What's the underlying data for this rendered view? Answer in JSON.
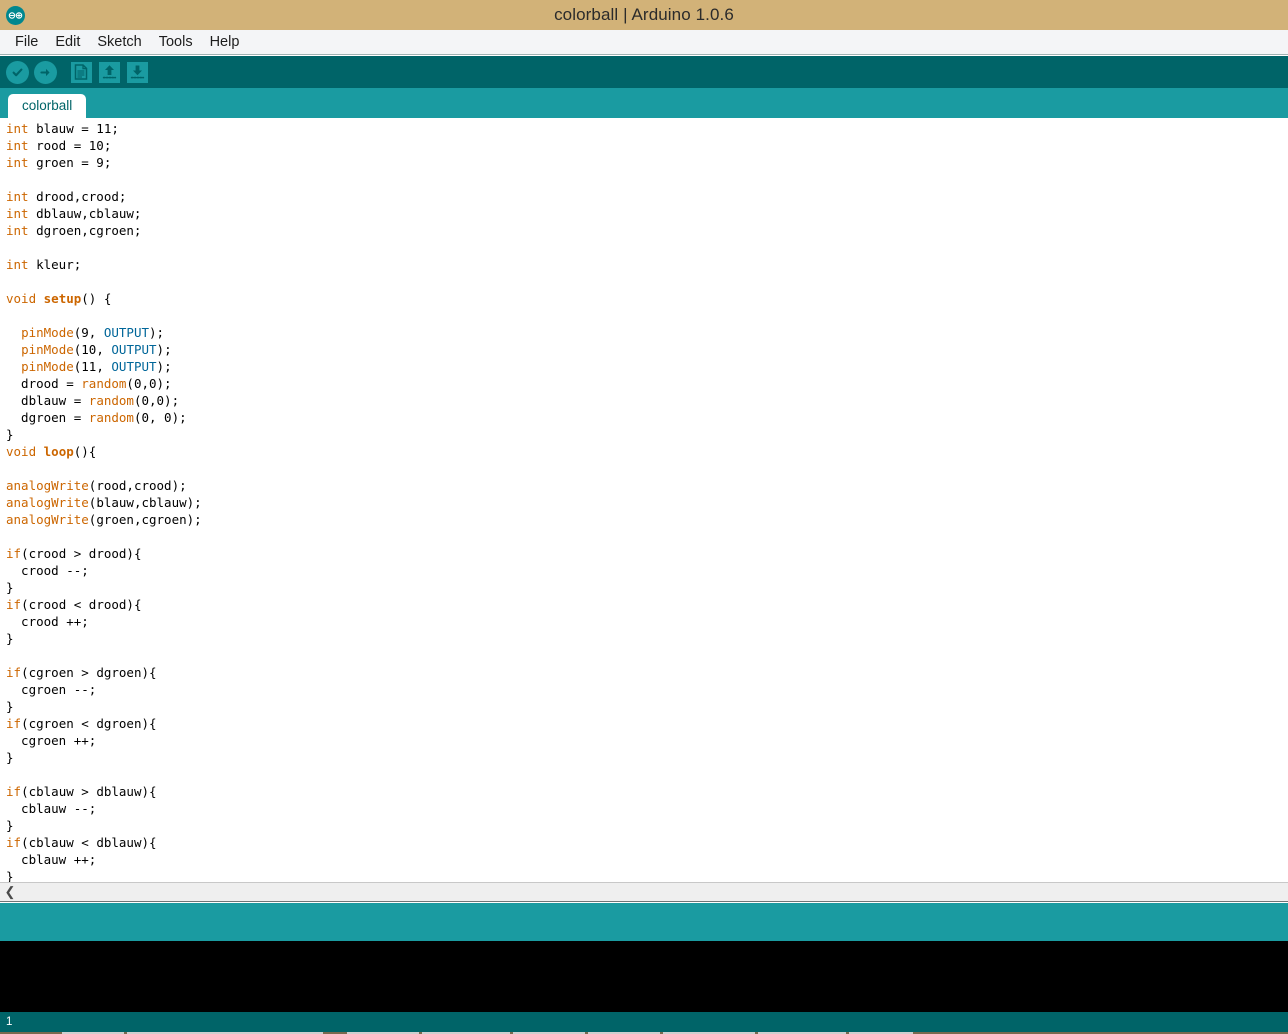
{
  "window": {
    "title": "colorball | Arduino 1.0.6",
    "logo_icon": "arduino-infinity-icon",
    "titlebar_color": "#d2b278",
    "accent_color": "#1a9ba1",
    "dark_accent_color": "#006468"
  },
  "menubar": {
    "items": [
      {
        "label": "File",
        "name": "menu-file"
      },
      {
        "label": "Edit",
        "name": "menu-edit"
      },
      {
        "label": "Sketch",
        "name": "menu-sketch"
      },
      {
        "label": "Tools",
        "name": "menu-tools"
      },
      {
        "label": "Help",
        "name": "menu-help"
      }
    ]
  },
  "toolbar": {
    "buttons": [
      {
        "name": "verify-button",
        "icon": "checkmark-icon",
        "tooltip": "Verify"
      },
      {
        "name": "upload-button",
        "icon": "right-arrow-icon",
        "tooltip": "Upload"
      },
      {
        "name": "new-button",
        "icon": "new-document-icon",
        "tooltip": "New"
      },
      {
        "name": "open-button",
        "icon": "up-arrow-icon",
        "tooltip": "Open"
      },
      {
        "name": "save-button",
        "icon": "down-arrow-icon",
        "tooltip": "Save"
      }
    ]
  },
  "tabs": [
    {
      "label": "colorball",
      "active": true
    }
  ],
  "editor": {
    "lines": [
      [
        {
          "t": "int",
          "c": "kw"
        },
        {
          "t": " blauw = 11;",
          "c": ""
        }
      ],
      [
        {
          "t": "int",
          "c": "kw"
        },
        {
          "t": " rood = 10;",
          "c": ""
        }
      ],
      [
        {
          "t": "int",
          "c": "kw"
        },
        {
          "t": " groen = 9;",
          "c": ""
        }
      ],
      [],
      [
        {
          "t": "int",
          "c": "kw"
        },
        {
          "t": " drood,crood;",
          "c": ""
        }
      ],
      [
        {
          "t": "int",
          "c": "kw"
        },
        {
          "t": " dblauw,cblauw;",
          "c": ""
        }
      ],
      [
        {
          "t": "int",
          "c": "kw"
        },
        {
          "t": " dgroen,cgroen;",
          "c": ""
        }
      ],
      [],
      [
        {
          "t": "int",
          "c": "kw"
        },
        {
          "t": " kleur;",
          "c": ""
        }
      ],
      [],
      [
        {
          "t": "void",
          "c": "kw"
        },
        {
          "t": " ",
          "c": ""
        },
        {
          "t": "setup",
          "c": "kw2"
        },
        {
          "t": "() {",
          "c": ""
        }
      ],
      [],
      [
        {
          "t": "  ",
          "c": ""
        },
        {
          "t": "pinMode",
          "c": "fn"
        },
        {
          "t": "(9, ",
          "c": ""
        },
        {
          "t": "OUTPUT",
          "c": "lit"
        },
        {
          "t": ");",
          "c": ""
        }
      ],
      [
        {
          "t": "  ",
          "c": ""
        },
        {
          "t": "pinMode",
          "c": "fn"
        },
        {
          "t": "(10, ",
          "c": ""
        },
        {
          "t": "OUTPUT",
          "c": "lit"
        },
        {
          "t": ");",
          "c": ""
        }
      ],
      [
        {
          "t": "  ",
          "c": ""
        },
        {
          "t": "pinMode",
          "c": "fn"
        },
        {
          "t": "(11, ",
          "c": ""
        },
        {
          "t": "OUTPUT",
          "c": "lit"
        },
        {
          "t": ");",
          "c": ""
        }
      ],
      [
        {
          "t": "  drood = ",
          "c": ""
        },
        {
          "t": "random",
          "c": "fn"
        },
        {
          "t": "(0,0);",
          "c": ""
        }
      ],
      [
        {
          "t": "  dblauw = ",
          "c": ""
        },
        {
          "t": "random",
          "c": "fn"
        },
        {
          "t": "(0,0);",
          "c": ""
        }
      ],
      [
        {
          "t": "  dgroen = ",
          "c": ""
        },
        {
          "t": "random",
          "c": "fn"
        },
        {
          "t": "(0, 0);",
          "c": ""
        }
      ],
      [
        {
          "t": "}",
          "c": ""
        }
      ],
      [
        {
          "t": "void",
          "c": "kw"
        },
        {
          "t": " ",
          "c": ""
        },
        {
          "t": "loop",
          "c": "kw2"
        },
        {
          "t": "(){",
          "c": ""
        }
      ],
      [],
      [
        {
          "t": "analogWrite",
          "c": "fn"
        },
        {
          "t": "(rood,crood);",
          "c": ""
        }
      ],
      [
        {
          "t": "analogWrite",
          "c": "fn"
        },
        {
          "t": "(blauw,cblauw);",
          "c": ""
        }
      ],
      [
        {
          "t": "analogWrite",
          "c": "fn"
        },
        {
          "t": "(groen,cgroen);",
          "c": ""
        }
      ],
      [],
      [
        {
          "t": "if",
          "c": "kw"
        },
        {
          "t": "(crood > drood){",
          "c": ""
        }
      ],
      [
        {
          "t": "  crood --;",
          "c": ""
        }
      ],
      [
        {
          "t": "}",
          "c": ""
        }
      ],
      [
        {
          "t": "if",
          "c": "kw"
        },
        {
          "t": "(crood < drood){",
          "c": ""
        }
      ],
      [
        {
          "t": "  crood ++;",
          "c": ""
        }
      ],
      [
        {
          "t": "}",
          "c": ""
        }
      ],
      [],
      [
        {
          "t": "if",
          "c": "kw"
        },
        {
          "t": "(cgroen > dgroen){",
          "c": ""
        }
      ],
      [
        {
          "t": "  cgroen --;",
          "c": ""
        }
      ],
      [
        {
          "t": "}",
          "c": ""
        }
      ],
      [
        {
          "t": "if",
          "c": "kw"
        },
        {
          "t": "(cgroen < dgroen){",
          "c": ""
        }
      ],
      [
        {
          "t": "  cgroen ++;",
          "c": ""
        }
      ],
      [
        {
          "t": "}",
          "c": ""
        }
      ],
      [],
      [
        {
          "t": "if",
          "c": "kw"
        },
        {
          "t": "(cblauw > dblauw){",
          "c": ""
        }
      ],
      [
        {
          "t": "  cblauw --;",
          "c": ""
        }
      ],
      [
        {
          "t": "}",
          "c": ""
        }
      ],
      [
        {
          "t": "if",
          "c": "kw"
        },
        {
          "t": "(cblauw < dblauw){",
          "c": ""
        }
      ],
      [
        {
          "t": "  cblauw ++;",
          "c": ""
        }
      ],
      [
        {
          "t": "}",
          "c": ""
        }
      ]
    ]
  },
  "scrollbar": {
    "left_arrow_glyph": "❮"
  },
  "status": {
    "message": ""
  },
  "console": {
    "text": ""
  },
  "footer": {
    "line_number": "1"
  }
}
